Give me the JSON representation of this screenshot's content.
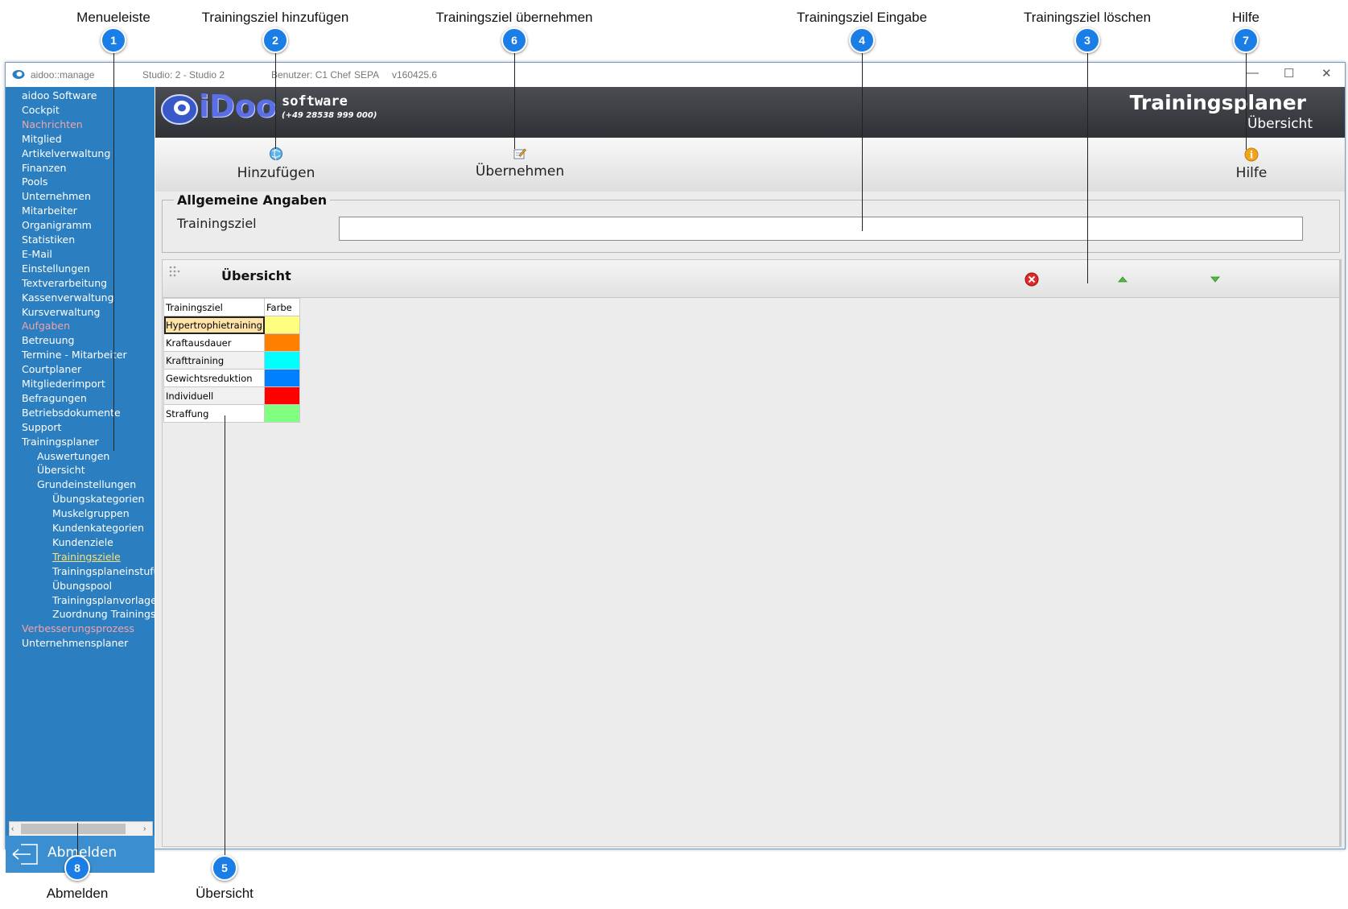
{
  "callouts": [
    {
      "num": "1",
      "label": "Menueleiste"
    },
    {
      "num": "2",
      "label": "Trainingsziel hinzufügen"
    },
    {
      "num": "6",
      "label": "Trainingsziel übernehmen"
    },
    {
      "num": "4",
      "label": "Trainingsziel Eingabe"
    },
    {
      "num": "3",
      "label": "Trainingsziel löschen"
    },
    {
      "num": "7",
      "label": "Hilfe"
    },
    {
      "num": "8",
      "label": "Abmelden"
    },
    {
      "num": "5",
      "label": "Übersicht"
    }
  ],
  "titlebar": {
    "app": "aidoo::manage",
    "studio": "Studio: 2 - Studio 2",
    "user": "Benutzer: C1 Chef",
    "sepa": "SEPA",
    "version": "v160425.6"
  },
  "sidebar": {
    "items": [
      {
        "label": "aidoo Software",
        "style": "normal"
      },
      {
        "label": "Cockpit",
        "style": "normal"
      },
      {
        "label": "Nachrichten",
        "style": "red"
      },
      {
        "label": "Mitglied",
        "style": "normal"
      },
      {
        "label": "Artikelverwaltung",
        "style": "normal"
      },
      {
        "label": "Finanzen",
        "style": "normal"
      },
      {
        "label": "Pools",
        "style": "normal"
      },
      {
        "label": "Unternehmen",
        "style": "normal"
      },
      {
        "label": "Mitarbeiter",
        "style": "normal"
      },
      {
        "label": "Organigramm",
        "style": "normal"
      },
      {
        "label": "Statistiken",
        "style": "normal"
      },
      {
        "label": "E-Mail",
        "style": "normal"
      },
      {
        "label": "Einstellungen",
        "style": "normal"
      },
      {
        "label": "Textverarbeitung",
        "style": "normal"
      },
      {
        "label": "Kassenverwaltung",
        "style": "normal"
      },
      {
        "label": "Kursverwaltung",
        "style": "normal"
      },
      {
        "label": "Aufgaben",
        "style": "red"
      },
      {
        "label": "Betreuung",
        "style": "normal"
      },
      {
        "label": "Termine - Mitarbeiter",
        "style": "normal"
      },
      {
        "label": "Courtplaner",
        "style": "normal"
      },
      {
        "label": "Mitgliederimport",
        "style": "normal"
      },
      {
        "label": "Befragungen",
        "style": "normal"
      },
      {
        "label": "Betriebsdokumente",
        "style": "normal"
      },
      {
        "label": "Support",
        "style": "normal"
      },
      {
        "label": "Trainingsplaner",
        "style": "normal"
      },
      {
        "label": "Auswertungen",
        "style": "normal"
      },
      {
        "label": "Übersicht",
        "style": "normal"
      },
      {
        "label": "Grundeinstellungen",
        "style": "normal"
      },
      {
        "label": "Übungskategorien",
        "style": "normal"
      },
      {
        "label": "Muskelgruppen",
        "style": "normal"
      },
      {
        "label": "Kundenkategorien",
        "style": "normal"
      },
      {
        "label": "Kundenziele",
        "style": "normal"
      },
      {
        "label": "Trainingsziele",
        "style": "active"
      },
      {
        "label": "Trainingsplaneinstufung",
        "style": "normal"
      },
      {
        "label": "Übungspool",
        "style": "normal"
      },
      {
        "label": "Trainingsplanvorlagen",
        "style": "normal"
      },
      {
        "label": "Zuordnung Trainingsschwerpunkte",
        "style": "normal"
      },
      {
        "label": "Verbesserungsprozess",
        "style": "red"
      },
      {
        "label": "Unternehmensplaner",
        "style": "normal"
      }
    ],
    "logout_label": "Abmelden"
  },
  "header": {
    "logo_text": "iDoo",
    "logo_software": "software",
    "logo_phone": "(+49 28538 999 000)",
    "title": "Trainingsplaner",
    "subtitle": "Übersicht"
  },
  "toolbar": {
    "add_label": "Hinzufügen",
    "apply_label": "Übernehmen",
    "help_label": "Hilfe"
  },
  "form": {
    "group_title": "Allgemeine Angaben",
    "field_label": "Trainingsziel",
    "field_value": ""
  },
  "overview": {
    "title": "Übersicht",
    "columns": [
      "Trainingsziel",
      "Farbe"
    ],
    "rows": [
      {
        "name": "Hypertrophietraining",
        "color": "#ffff80"
      },
      {
        "name": "Kraftausdauer",
        "color": "#ff8000"
      },
      {
        "name": "Krafttraining",
        "color": "#00ffff"
      },
      {
        "name": "Gewichtsreduktion",
        "color": "#0080ff"
      },
      {
        "name": "Individuell",
        "color": "#ff0000"
      },
      {
        "name": "Straffung",
        "color": "#80ff80"
      }
    ]
  }
}
